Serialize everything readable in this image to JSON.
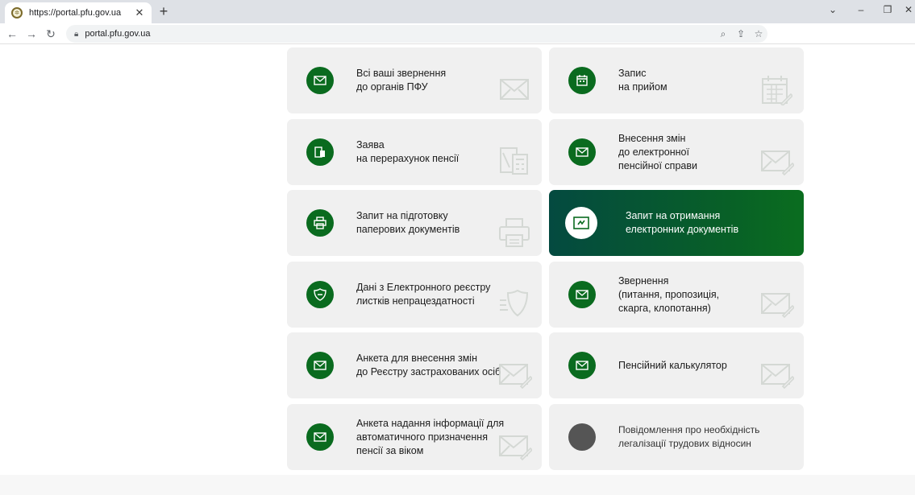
{
  "browser": {
    "tab_title": "https://portal.pfu.gov.ua",
    "url": "portal.pfu.gov.ua"
  },
  "colors": {
    "accent": "#0a6b1f",
    "card_bg": "#f0f0f0",
    "active_start": "#044a40",
    "active_end": "#0a6d1f"
  },
  "cards": [
    {
      "lines": [
        "Всі ваші звернення",
        "до органів ПФУ"
      ],
      "icon": "envelope-icon",
      "bg_icon": "envelope-icon"
    },
    {
      "lines": [
        "Запис",
        "на прийом"
      ],
      "icon": "calendar-icon",
      "bg_icon": "calendar-icon"
    },
    {
      "lines": [
        "Заява",
        "на перерахунок пенсії"
      ],
      "icon": "document-calculator-icon",
      "bg_icon": "calculator-icon"
    },
    {
      "lines": [
        "Внесення змін",
        "до електронної",
        "пенсійної справи"
      ],
      "icon": "envelope-icon",
      "bg_icon": "envelope-edit-icon"
    },
    {
      "lines": [
        "Запит на підготовку",
        "паперових документів"
      ],
      "icon": "printer-icon",
      "bg_icon": "printer-icon"
    },
    {
      "lines": [
        "Запит на отримання",
        "електронних документів"
      ],
      "icon": "e-document-icon",
      "bg_icon": "",
      "active": true
    },
    {
      "lines": [
        "Дані з Електронного реєстру",
        "листків непрацездатності"
      ],
      "icon": "shield-icon",
      "bg_icon": "shield-icon"
    },
    {
      "lines": [
        "Звернення",
        "(питання, пропозиція,",
        "скарга, клопотання)"
      ],
      "icon": "envelope-icon",
      "bg_icon": "envelope-edit-icon"
    },
    {
      "lines": [
        "Анкета для внесення змін",
        "до Реєстру застрахованих осіб"
      ],
      "icon": "envelope-icon",
      "bg_icon": "envelope-edit-icon"
    },
    {
      "lines": [
        "Пенсійний калькулятор"
      ],
      "icon": "envelope-icon",
      "bg_icon": "envelope-edit-icon"
    },
    {
      "lines": [
        "Анкета надання інформації для",
        "автоматичного призначення",
        "пенсії за віком"
      ],
      "icon": "envelope-icon",
      "bg_icon": "envelope-edit-icon"
    },
    {
      "lines": [
        "Повідомлення про необхідність",
        "легалізації трудових відносин"
      ],
      "icon": "gray-circle-icon",
      "bg_icon": "",
      "gray": true
    }
  ]
}
